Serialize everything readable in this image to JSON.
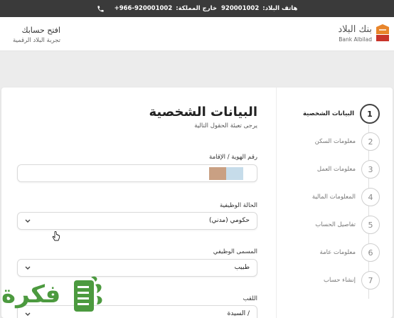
{
  "topbar": {
    "local_label": "هاتف البلاد:",
    "local_number": "920001002",
    "abroad_label": "خارج المملكة:",
    "abroad_number": "+966-920001002"
  },
  "header": {
    "logo_ar": "بنك البلاد",
    "logo_en": "Bank Albilad",
    "open_account": "افتح حسابك",
    "digital_experience": "تجربة البلاد الرقمية"
  },
  "steps": [
    {
      "num": "1",
      "label": "البيانات الشخصية"
    },
    {
      "num": "2",
      "label": "معلومات السكن"
    },
    {
      "num": "3",
      "label": "معلومات العمل"
    },
    {
      "num": "4",
      "label": "المعلومات المالية"
    },
    {
      "num": "5",
      "label": "تفاصيل الحساب"
    },
    {
      "num": "6",
      "label": "معلومات عامة"
    },
    {
      "num": "7",
      "label": "إنشاء حساب"
    }
  ],
  "form": {
    "title": "البيانات الشخصية",
    "subtitle": "يرجى تعبئة الحقول التالية",
    "id_label": "رقم الهوية / الإقامة",
    "employment_label": "الحالة الوظيفية",
    "employment_value": "حكومي (مدني)",
    "job_title_label": "المسمى الوظيفي",
    "job_title_value": "طبيب",
    "honorific_label": "اللقب",
    "honorific_value": "/ السيدة"
  },
  "watermark": {
    "text": "فكرة"
  },
  "colors": {
    "topbar": "#3a3a3a",
    "brand_orange": "#e8852b",
    "brand_red": "#c8342a",
    "watermark_green": "#4c9a3f"
  }
}
